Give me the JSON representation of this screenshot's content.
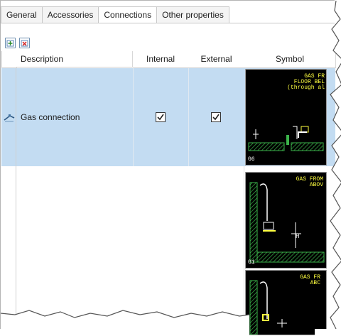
{
  "tabs": [
    "General",
    "Accessories",
    "Connections",
    "Other properties"
  ],
  "active_tab": "Connections",
  "toolbar": {
    "add_icon": "add-row-icon",
    "delete_icon": "delete-row-icon"
  },
  "table": {
    "columns": [
      "Description",
      "Internal",
      "External",
      "Symbol"
    ],
    "rows": [
      {
        "icon": "gas-connection-icon",
        "description": "Gas connection",
        "internal": true,
        "external": true
      }
    ]
  },
  "symbols": [
    {
      "label": "GAS FR\nFLOOR BEL\n(through al",
      "code": "G6"
    },
    {
      "label": "GAS FROM\nABOV",
      "code": "G1"
    },
    {
      "label": "GAS FR\nABC",
      "code": ""
    }
  ],
  "colors": {
    "selected_row": "#c3dcf2",
    "symbol_background": "#000000",
    "symbol_text": "#ffff40",
    "symbol_hatch": "#3cb44b"
  }
}
